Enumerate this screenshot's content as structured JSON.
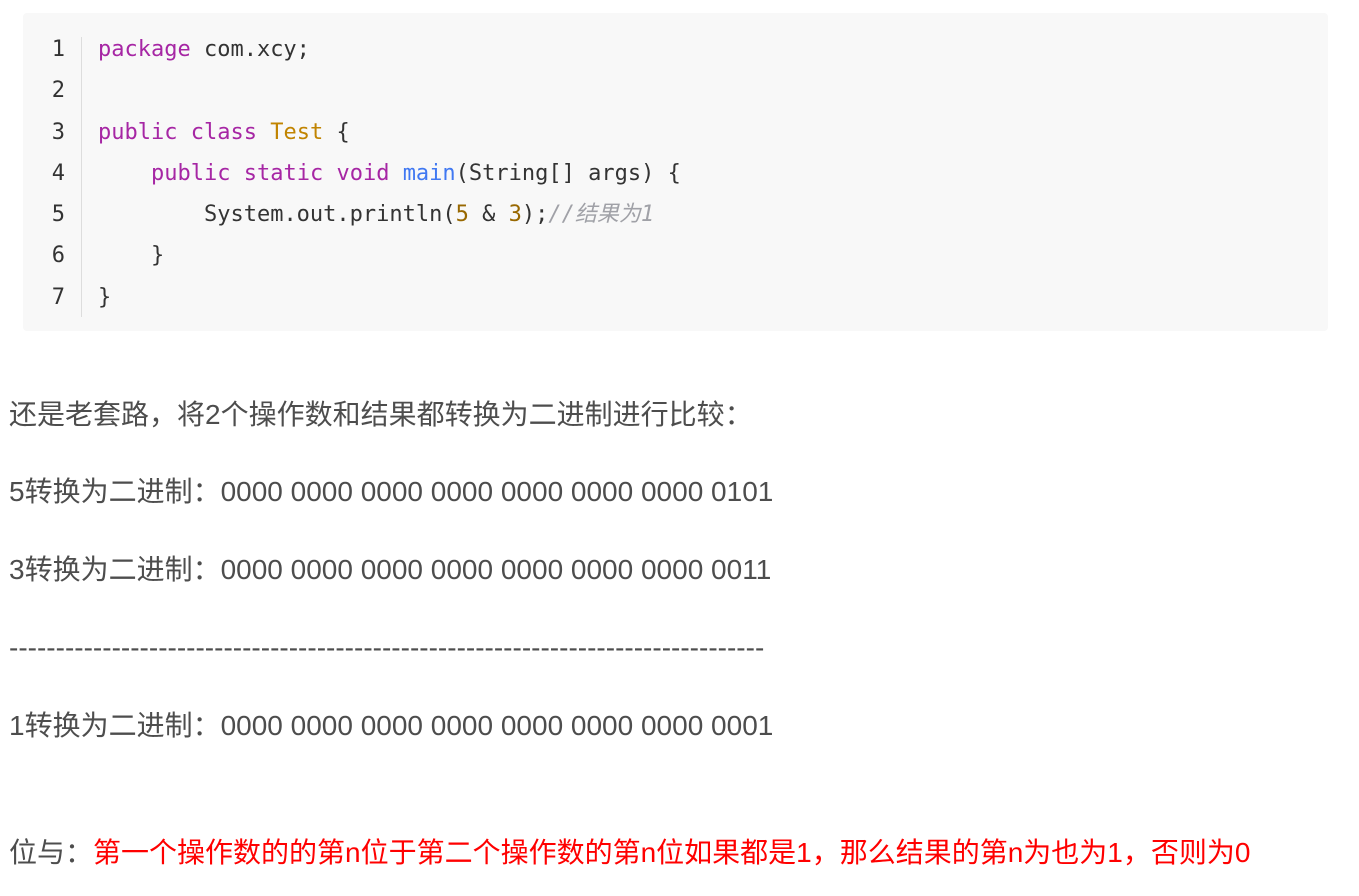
{
  "code": {
    "line_numbers": [
      "1",
      "2",
      "3",
      "4",
      "5",
      "6",
      "7"
    ],
    "lines": [
      {
        "k1": "package",
        "t1": " com.xcy;"
      },
      {},
      {
        "k1": "public",
        "s1": " ",
        "k2": "class",
        "s2": " ",
        "c1": "Test",
        "t1": " {"
      },
      {
        "indent": "    ",
        "k1": "public",
        "s1": " ",
        "k2": "static",
        "s2": " ",
        "k3": "void",
        "s3": " ",
        "f1": "main",
        "t1": "(String[] args) {"
      },
      {
        "indent": "        ",
        "t1": "System.out.println(",
        "n1": "5",
        "t2": " & ",
        "n2": "3",
        "t3": ");",
        "cm": "//结果为1"
      },
      {
        "indent": "    ",
        "t1": "}"
      },
      {
        "t1": "}"
      }
    ]
  },
  "paragraphs": {
    "p1": "还是老套路，将2个操作数和结果都转换为二进制进行比较：",
    "p2": "5转换为二进制：0000 0000 0000 0000 0000 0000 0000 0101",
    "p3": "3转换为二进制：0000 0000 0000 0000 0000 0000 0000 0011",
    "divider": "---------------------------------------------------------------------------------",
    "p4": "1转换为二进制：0000 0000 0000 0000 0000 0000 0000 0001",
    "p5_label": "位与：",
    "p5_red": "第一个操作数的的第n位于第二个操作数的第n位如果都是1，那么结果的第n为也为1，否则为0"
  },
  "colors": {
    "keyword": "#a626a4",
    "class_name": "#c18401",
    "function": "#4078f2",
    "number": "#986801",
    "comment": "#a0a1a7",
    "highlight_red": "#ff0000"
  }
}
